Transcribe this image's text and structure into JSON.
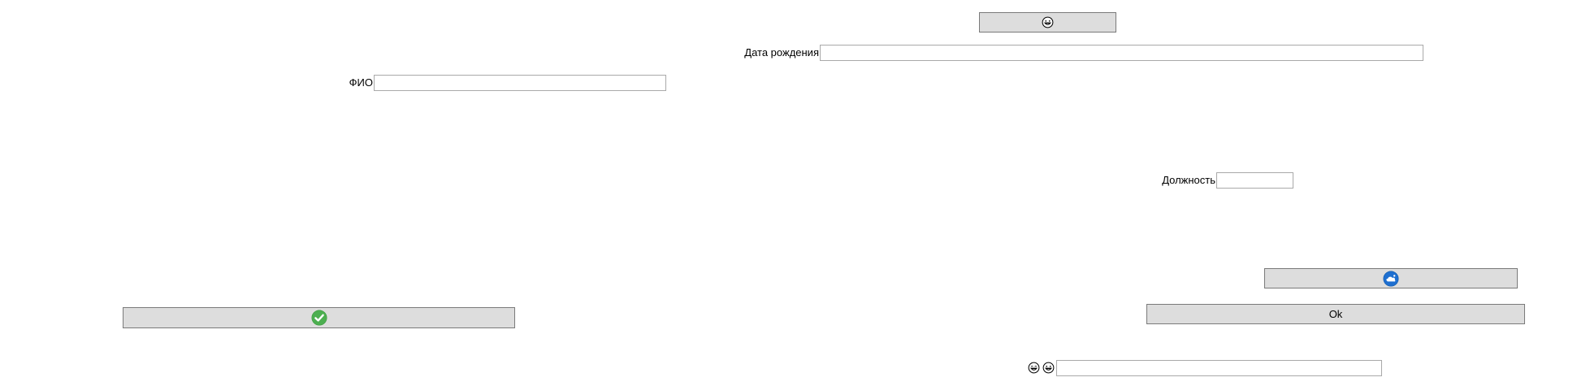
{
  "form": {
    "fio_label": "ФИО",
    "fio_value": "",
    "birthdate_label": "Дата рождения",
    "birthdate_value": "",
    "position_label": "Должность",
    "position_value": "",
    "bottom_field_value": "",
    "ok_label": "Ok"
  },
  "icons": {
    "top_button_icon": "grinning-face-icon",
    "check_button_icon": "check-circle-icon",
    "cloud_button_icon": "cloud-circle-icon",
    "bottom_left_icon_1": "laughing-face-icon",
    "bottom_left_icon_2": "grinning-face-icon"
  },
  "colors": {
    "button_bg": "#dddddd",
    "check_green": "#4caf50",
    "cloud_blue": "#1e6fd0"
  }
}
